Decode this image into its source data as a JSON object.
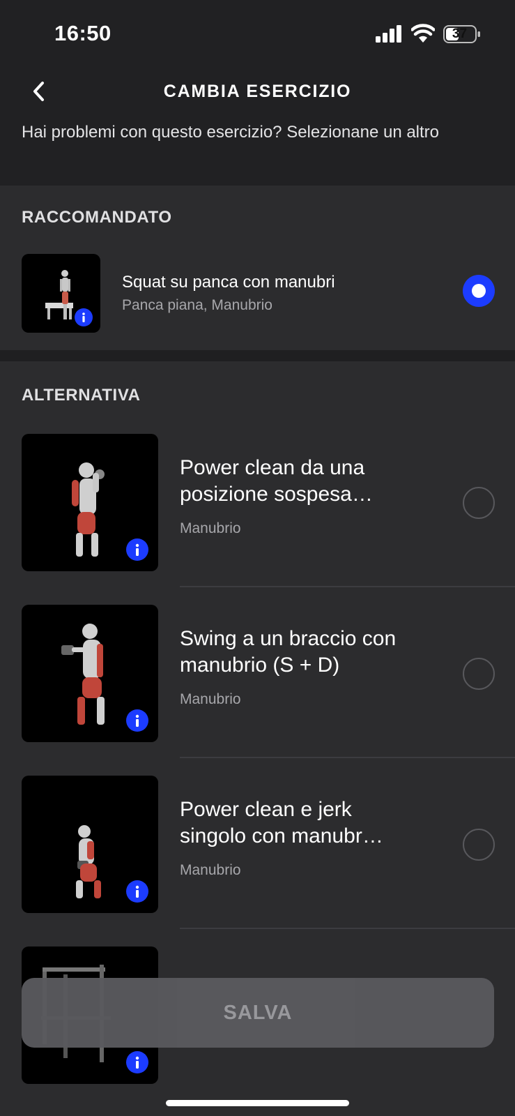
{
  "status_bar": {
    "time": "16:50",
    "battery": "37"
  },
  "header": {
    "title": "CAMBIA ESERCIZIO",
    "subtitle": "Hai problemi con questo esercizio? Selezionane un altro"
  },
  "recommended": {
    "section_title": "RACCOMANDATO",
    "item": {
      "name": "Squat su panca con manubri",
      "equipment": "Panca piana, Manubrio",
      "selected": true
    }
  },
  "alternatives": {
    "section_title": "ALTERNATIVA",
    "items": [
      {
        "name": "Power clean da una posizione sospesa…",
        "equipment": "Manubrio",
        "selected": false
      },
      {
        "name": "Swing a un braccio con manubrio (S + D)",
        "equipment": "Manubrio",
        "selected": false
      },
      {
        "name": "Power clean e jerk singolo con manubr…",
        "equipment": "Manubrio",
        "selected": false
      }
    ]
  },
  "footer": {
    "save_label": "SALVA"
  },
  "colors": {
    "accent": "#1c3cff",
    "background": "#2c2c2e",
    "header_bg": "#212123"
  }
}
